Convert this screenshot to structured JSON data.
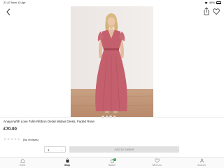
{
  "status_bar": {
    "time_date": "21:47  Mon 13 Apr",
    "battery": "46%"
  },
  "product": {
    "title": "Anaya With Love Tulle Ribbon Detail Midaxi Dress, Faded Rose",
    "price": "£70.00",
    "reviews_label": "(No reviews)",
    "rating": 0,
    "rating_max": 5,
    "image_count": 4,
    "active_image": 1,
    "dress_color": "#c4606d"
  },
  "purchase": {
    "quantity": "1",
    "add_label": "Add to basket"
  },
  "tabs": [
    {
      "label": "Home",
      "icon": "home-icon",
      "active": false
    },
    {
      "label": "Shop",
      "icon": "shop-icon",
      "active": true
    },
    {
      "label": "Basket",
      "icon": "basket-icon",
      "active": false,
      "badge": "0"
    },
    {
      "label": "Wish List",
      "icon": "heart-icon",
      "active": false
    },
    {
      "label": "Account",
      "icon": "account-icon",
      "active": false
    }
  ],
  "colors": {
    "badge": "#17a34a",
    "disabled_button": "#e1e1e1"
  }
}
